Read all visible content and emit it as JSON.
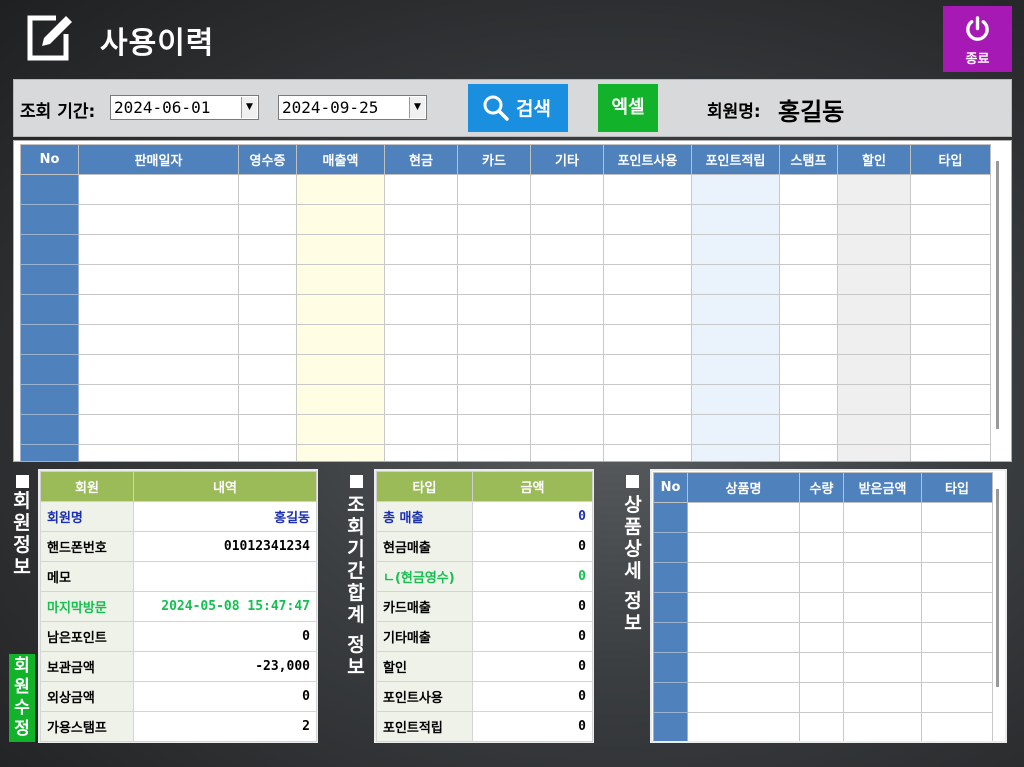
{
  "header": {
    "title": "사용이력",
    "title_icon": "edit-square-icon",
    "exit_icon": "power-icon",
    "exit_label": "종료",
    "exit_color": "#a619b5"
  },
  "filter": {
    "period_label": "조회 기간:",
    "start_date": "2024-06-01",
    "end_date": "2024-09-25",
    "search_label": "검색",
    "search_icon": "search-icon",
    "excel_label": "엑셀",
    "member_label": "회원명:",
    "member_name": "홍길동",
    "search_color": "#1a8fe0",
    "excel_color": "#12b22a"
  },
  "main_table": {
    "columns": [
      "No",
      "판매일자",
      "영수증",
      "매출액",
      "현금",
      "카드",
      "기타",
      "포인트사용",
      "포인트적립",
      "스탬프",
      "할인",
      "타입"
    ],
    "row_count": 10
  },
  "member_panel": {
    "side_label": "회원정보",
    "edit_label": "회원수정",
    "headers": [
      "회원",
      "내역"
    ],
    "rows": [
      {
        "key": "회원명",
        "value": "홍길동",
        "style": "blue"
      },
      {
        "key": "핸드폰번호",
        "value": "01012341234",
        "style": ""
      },
      {
        "key": "메모",
        "value": "",
        "style": ""
      },
      {
        "key": "마지막방문",
        "value": "2024-05-08 15:47:47",
        "style": "green"
      },
      {
        "key": "남은포인트",
        "value": "0",
        "style": ""
      },
      {
        "key": "보관금액",
        "value": "-23,000",
        "style": ""
      },
      {
        "key": "외상금액",
        "value": "0",
        "style": ""
      },
      {
        "key": "가용스탬프",
        "value": "2",
        "style": ""
      }
    ]
  },
  "summary_panel": {
    "side_label": "조회기간합계 정보",
    "headers": [
      "타입",
      "금액"
    ],
    "rows": [
      {
        "key": "총  매출",
        "value": "0",
        "style": "blue"
      },
      {
        "key": "현금매출",
        "value": "0",
        "style": ""
      },
      {
        "key": "ㄴ(현금영수)",
        "value": "0",
        "style": "green"
      },
      {
        "key": "카드매출",
        "value": "0",
        "style": ""
      },
      {
        "key": "기타매출",
        "value": "0",
        "style": ""
      },
      {
        "key": "할인",
        "value": "0",
        "style": ""
      },
      {
        "key": "포인트사용",
        "value": "0",
        "style": ""
      },
      {
        "key": "포인트적립",
        "value": "0",
        "style": ""
      }
    ]
  },
  "detail_panel": {
    "side_label": "상품상세 정보",
    "columns": [
      "No",
      "상품명",
      "수량",
      "받은금액",
      "타입"
    ],
    "row_count": 8
  }
}
